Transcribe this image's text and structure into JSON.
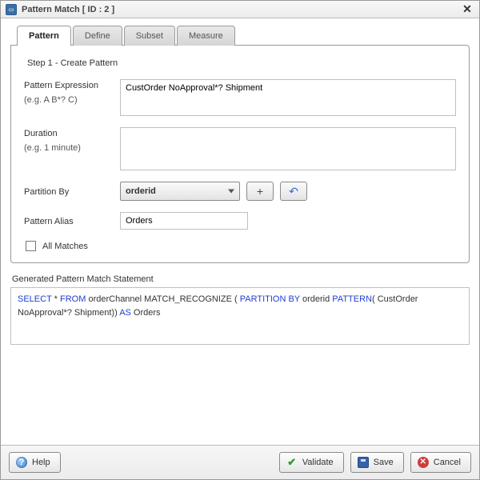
{
  "title": "Pattern Match [ ID : 2 ]",
  "tabs": {
    "pattern": "Pattern",
    "define": "Define",
    "subset": "Subset",
    "measure": "Measure"
  },
  "step_title": "Step 1 - Create Pattern",
  "labels": {
    "pattern_expression": "Pattern Expression",
    "pattern_hint": "(e.g. A B*? C)",
    "duration": "Duration",
    "duration_hint": "(e.g. 1 minute)",
    "partition_by": "Partition By",
    "pattern_alias": "Pattern Alias",
    "all_matches": "All Matches",
    "generated": "Generated Pattern Match Statement"
  },
  "values": {
    "pattern_expression": "CustOrder NoApproval*? Shipment",
    "duration": "",
    "partition_by_selected": "orderid",
    "pattern_alias": "Orders"
  },
  "sql": {
    "kw_select": "SELECT",
    "star": " * ",
    "kw_from": "FROM",
    "from_tail": " orderChannel  MATCH_RECOGNIZE ( ",
    "kw_partition": "PARTITION BY",
    "partition_tail": " orderid ",
    "kw_pattern": "PATTERN",
    "pattern_tail": "( CustOrder NoApproval*? Shipment)) ",
    "kw_as": "AS",
    "as_tail": " Orders"
  },
  "buttons": {
    "help": "Help",
    "validate": "Validate",
    "save": "Save",
    "cancel": "Cancel",
    "plus": "+"
  }
}
